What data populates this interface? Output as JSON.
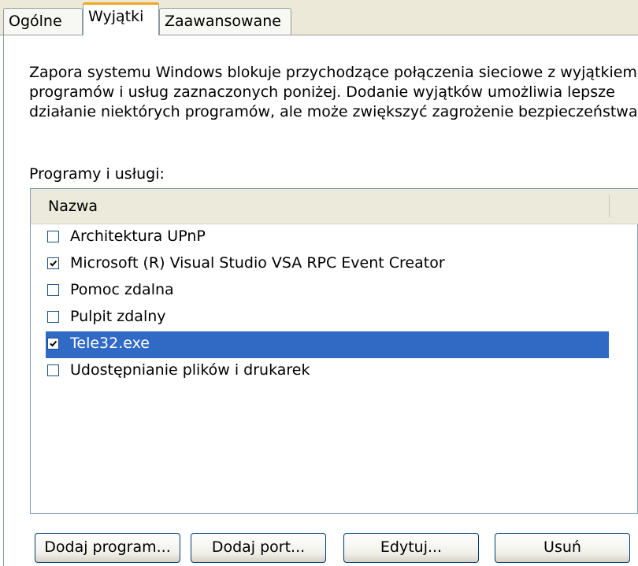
{
  "tabs": [
    {
      "label": "Ogólne",
      "active": false
    },
    {
      "label": "Wyjątki",
      "active": true
    },
    {
      "label": "Zaawansowane",
      "active": false
    }
  ],
  "description": "Zapora systemu Windows blokuje przychodzące połączenia sieciowe z wyjątkiem\nprogramów i usług zaznaczonych poniżej. Dodanie wyjątków umożliwia lepsze\ndziałanie niektórych programów, ale może zwiększyć zagrożenie bezpieczeństwa.",
  "list": {
    "label": "Programy i usługi:",
    "column_header": "Nazwa",
    "items": [
      {
        "label": "Architektura UPnP",
        "checked": false,
        "selected": false
      },
      {
        "label": "Microsoft (R) Visual Studio VSA RPC Event Creator",
        "checked": true,
        "selected": false
      },
      {
        "label": "Pomoc zdalna",
        "checked": false,
        "selected": false
      },
      {
        "label": "Pulpit zdalny",
        "checked": false,
        "selected": false
      },
      {
        "label": "Tele32.exe",
        "checked": true,
        "selected": true
      },
      {
        "label": "Udostępnianie plików i drukarek",
        "checked": false,
        "selected": false
      }
    ]
  },
  "buttons": {
    "add_program": "Dodaj program...",
    "add_port": "Dodaj port...",
    "edit": "Edytuj...",
    "delete": "Usuń"
  },
  "colors": {
    "selection": "#316ac5",
    "active_tab_accent": "#f0a623",
    "dialog_background": "#ece9d8"
  }
}
